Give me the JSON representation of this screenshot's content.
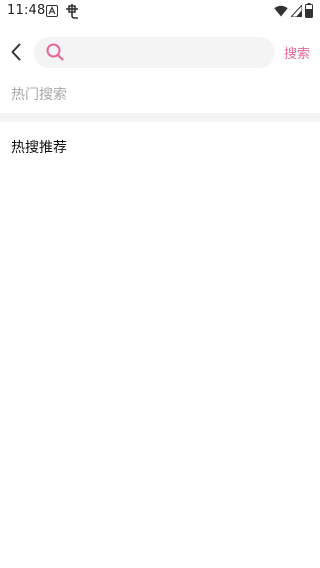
{
  "status_bar": {
    "time": "11:48",
    "icons": [
      "notification-a-icon",
      "notification-bug-icon",
      "wifi-icon",
      "signal-icon",
      "battery-icon"
    ]
  },
  "search": {
    "back_icon": "chevron-left-icon",
    "search_icon": "search-icon",
    "placeholder": "",
    "value": "",
    "submit_label": "搜索"
  },
  "sections": {
    "hot_searches_title": "热门搜索",
    "hot_recommend_title": "热搜推荐"
  },
  "colors": {
    "accent": "#e7679b",
    "muted_text": "#a8a8a8",
    "search_bg": "#f4f4f4",
    "divider": "#f3f3f3"
  }
}
